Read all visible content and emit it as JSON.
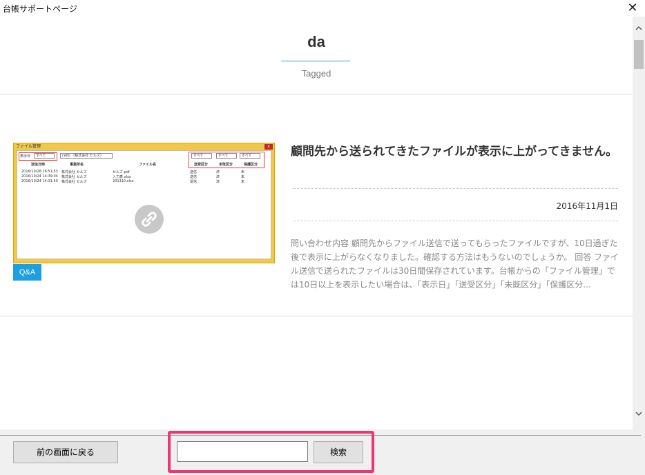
{
  "window": {
    "title": "台帳サポートページ",
    "close_glyph": "✕"
  },
  "header": {
    "title": "da",
    "subtitle": "Tagged"
  },
  "article": {
    "title": "顧問先から送られてきたファイルが表示に上がってきません。",
    "date": "2016年11月1日",
    "excerpt": "問い合わせ内容 顧問先からファイル送信で送ってもらったファイルですが、10日過ぎた後で表示に上がらなくなりました。確認する方法はもうないのでしょうか。 回答 ファイル送信で送られたファイルは30日間保存されています。台帳からの「ファイル管理」では10日以上を表示したい場合は、「表示日」「送受区分」「未既区分」「保護区分...",
    "badge": "Q&A",
    "thumbnail": {
      "window_title": "ファイル管理",
      "filter_label": "表示日",
      "filter_value": "すべて",
      "company_value": "cello （株式会社 セルズ）",
      "dropdowns": [
        "すべて",
        "すべて",
        "すべて"
      ],
      "columns": [
        "送信日時",
        "事業所名",
        "ファイル名",
        "送受区分",
        "未既区分",
        "保護区分"
      ],
      "rows": [
        [
          "2016/10/28 16:51:53",
          "株式会社 セルズ",
          "セルズ.pdf",
          "送信",
          "済",
          "未"
        ],
        [
          "2016/10/24 14:39:04",
          "株式会社 セルズ",
          "入力表.xlsx",
          "送信",
          "済",
          "未"
        ],
        [
          "2016/10/24 14:31:50",
          "株式会社 セルズ",
          "201310.xlsx",
          "受信",
          "済",
          "未"
        ]
      ]
    }
  },
  "footer": {
    "back_label": "前の画面に戻る",
    "search_value": "",
    "search_label": "検索"
  },
  "colors": {
    "accent": "#2a9bd6",
    "badge": "#1ea0e0",
    "highlight": "#f03470"
  },
  "icons": {
    "close": "close-icon",
    "link": "link-icon",
    "scroll_up": "chevron-up-icon",
    "scroll_down": "chevron-down-icon"
  }
}
